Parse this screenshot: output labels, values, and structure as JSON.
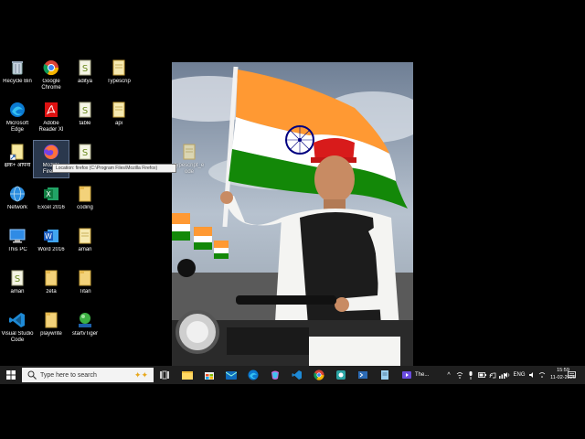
{
  "desktop": {
    "icons": [
      {
        "label": "Recycle Bin",
        "icon": "recycle-bin-icon"
      },
      {
        "label": "Google Chrome",
        "icon": "chrome-icon"
      },
      {
        "label": "aditya",
        "icon": "text-file-icon"
      },
      {
        "label": "Typescrip",
        "icon": "file-icon"
      },
      {
        "label": "Microsoft Edge",
        "icon": "edge-icon"
      },
      {
        "label": "Adobe Reader XI",
        "icon": "acrobat-icon"
      },
      {
        "label": "table",
        "icon": "text-file-icon"
      },
      {
        "label": "api",
        "icon": "file-icon"
      },
      {
        "label": "क्ष्रक+ अपिनी",
        "icon": "shortcut-icon"
      },
      {
        "label": "Mozilla Firefox",
        "icon": "firefox-icon"
      },
      {
        "label": "",
        "icon": "text-file-icon"
      },
      {
        "label": "Network",
        "icon": "network-icon"
      },
      {
        "label": "Excel 2016",
        "icon": "excel-icon"
      },
      {
        "label": "coding",
        "icon": "folder-icon"
      },
      {
        "label": "This PC",
        "icon": "this-pc-icon"
      },
      {
        "label": "Word 2016",
        "icon": "word-icon"
      },
      {
        "label": "aman",
        "icon": "file-icon"
      },
      {
        "label": "aman",
        "icon": "text-file-icon"
      },
      {
        "label": "zeta",
        "icon": "folder-icon"
      },
      {
        "label": "Titan",
        "icon": "folder-icon"
      },
      {
        "label": "Visual Studio Code",
        "icon": "vscode-icon"
      },
      {
        "label": "playwrite",
        "icon": "folder-icon"
      },
      {
        "label": "startvTiger",
        "icon": "tiger-icon"
      }
    ],
    "dragged_icon_label": "typescript_e ode",
    "tooltip": "Location: firefox (C:\\Program Files\\Mozilla Firefox)"
  },
  "taskbar": {
    "search_placeholder": "Type here to search",
    "active_window_label": "The...",
    "tray": {
      "language": "ENG",
      "time": "15:59",
      "date": "11-02-2026"
    }
  },
  "colors": {
    "taskbar_bg": "#1f1f1f",
    "saffron": "#FF9933",
    "green": "#138808",
    "navy": "#000080"
  }
}
